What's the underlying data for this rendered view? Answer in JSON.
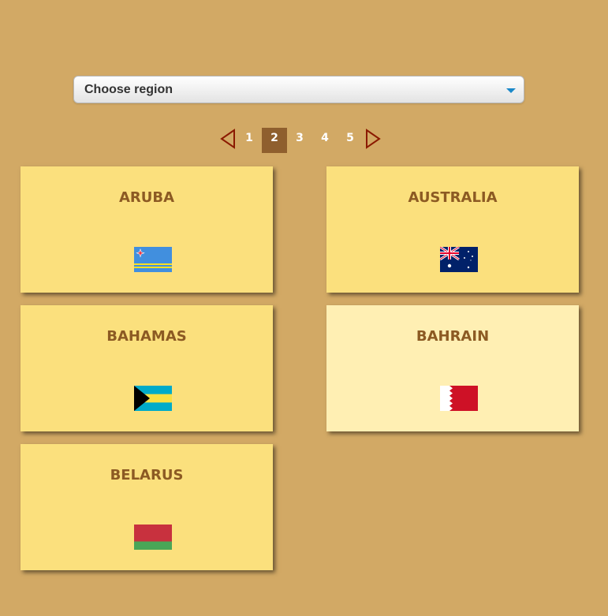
{
  "region_select": {
    "label": "Choose region"
  },
  "pagination": {
    "pages": [
      "1",
      "2",
      "3",
      "4",
      "5"
    ],
    "current": "2"
  },
  "countries": [
    {
      "name": "ARUBA",
      "flag": "aruba-flag-icon"
    },
    {
      "name": "AUSTRALIA",
      "flag": "australia-flag-icon"
    },
    {
      "name": "BAHAMAS",
      "flag": "bahamas-flag-icon"
    },
    {
      "name": "BAHRAIN",
      "flag": "bahrain-flag-icon",
      "highlighted": true
    },
    {
      "name": "BELARUS",
      "flag": "belarus-flag-icon"
    }
  ],
  "colors": {
    "background": "#d2a965",
    "card": "#fbe07d",
    "card_highlighted": "#ffefb3",
    "card_text": "#8c5a23",
    "active_page": "#8f5f2e",
    "arrow": "#8b1a00",
    "caret": "#1a88c9"
  }
}
